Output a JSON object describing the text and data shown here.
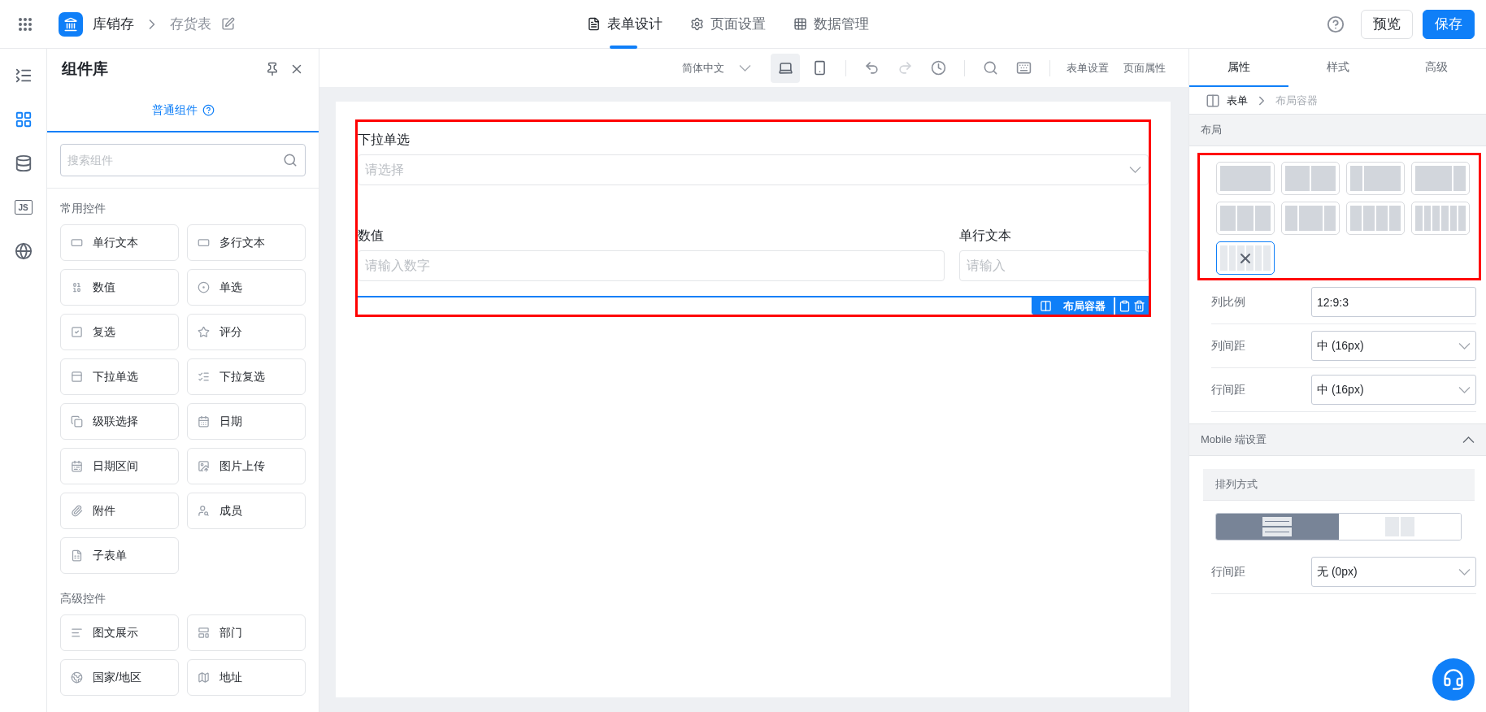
{
  "top_bar": {
    "app_name": "库销存",
    "breadcrumb": "存货表",
    "tabs": [
      {
        "kind": "form",
        "label": "表单设计",
        "selected": true
      },
      {
        "kind": "settings",
        "label": "页面设置",
        "selected": false
      },
      {
        "kind": "table",
        "label": "数据管理",
        "selected": false
      }
    ],
    "preview_button": "预览",
    "save_button": "保存"
  },
  "side_rail": [
    {
      "kind": "outline",
      "selected": false
    },
    {
      "kind": "components",
      "selected": true
    },
    {
      "kind": "data-source",
      "selected": false
    },
    {
      "kind": "script",
      "label": "JS",
      "selected": false
    },
    {
      "kind": "globe",
      "selected": false
    }
  ],
  "component_panel": {
    "title": "组件库",
    "tab": {
      "label": "普通组件",
      "selected": true
    },
    "search": {
      "placeholder": "搜索组件"
    },
    "groups": [
      {
        "title": "常用控件",
        "items": [
          {
            "kind": "text",
            "label": "单行文本"
          },
          {
            "kind": "textarea",
            "label": "多行文本"
          },
          {
            "kind": "number",
            "label": "数值"
          },
          {
            "kind": "radio",
            "label": "单选"
          },
          {
            "kind": "checkbox",
            "label": "复选"
          },
          {
            "kind": "rating",
            "label": "评分"
          },
          {
            "kind": "select",
            "label": "下拉单选"
          },
          {
            "kind": "multiselect",
            "label": "下拉复选"
          },
          {
            "kind": "cascade",
            "label": "级联选择"
          },
          {
            "kind": "date",
            "label": "日期"
          },
          {
            "kind": "daterange",
            "label": "日期区间"
          },
          {
            "kind": "image",
            "label": "图片上传"
          },
          {
            "kind": "attachment",
            "label": "附件"
          },
          {
            "kind": "member",
            "label": "成员"
          },
          {
            "kind": "subform",
            "label": "子表单"
          }
        ]
      },
      {
        "title": "高级控件",
        "items": [
          {
            "kind": "richtext",
            "label": "图文展示"
          },
          {
            "kind": "department",
            "label": "部门"
          },
          {
            "kind": "country",
            "label": "国家/地区"
          },
          {
            "kind": "address",
            "label": "地址"
          }
        ]
      }
    ]
  },
  "canvas_toolbar": {
    "language": "简体中文",
    "devices": [
      {
        "kind": "desktop",
        "selected": true
      },
      {
        "kind": "mobile",
        "selected": false
      }
    ],
    "links": [
      "表单设置",
      "页面属性"
    ]
  },
  "form": {
    "highlighted": true,
    "rows": [
      {
        "fields": [
          {
            "kind": "select",
            "label": "下拉单选",
            "placeholder": "请选择"
          }
        ]
      },
      {
        "fields": [
          {
            "kind": "input",
            "label": "数值",
            "placeholder": "请输入数字"
          },
          {
            "kind": "input",
            "label": "单行文本",
            "placeholder": "请输入"
          }
        ]
      }
    ],
    "container_tag": "布局容器"
  },
  "properties": {
    "tabs": [
      {
        "label": "属性",
        "selected": true
      },
      {
        "label": "样式",
        "selected": false
      },
      {
        "label": "高级",
        "selected": false
      }
    ],
    "breadcrumb": [
      "表单",
      "布局容器"
    ],
    "layout_section": "布局",
    "layout_options": {
      "highlighted": true,
      "items": [
        {
          "kind": "one",
          "selected": false
        },
        {
          "kind": "halves",
          "selected": false
        },
        {
          "kind": "narrow-wide",
          "selected": false
        },
        {
          "kind": "wide-narrow",
          "selected": false
        },
        {
          "kind": "thirds",
          "selected": false
        },
        {
          "kind": "narrow-wide-narrow",
          "selected": false
        },
        {
          "kind": "quarters",
          "selected": false
        },
        {
          "kind": "sixths",
          "selected": false
        },
        {
          "kind": "custom",
          "selected": true
        }
      ]
    },
    "fields": [
      {
        "kind": "input",
        "label": "列比例",
        "value": "12:9:3"
      },
      {
        "kind": "select",
        "label": "列间距",
        "value": "中 (16px)"
      },
      {
        "kind": "select",
        "label": "行间距",
        "value": "中 (16px)"
      }
    ],
    "mobile_section": {
      "title": "Mobile 端设置",
      "expanded": true,
      "arrangement_title": "排列方式",
      "arrangement": [
        {
          "kind": "stacked",
          "selected": true
        },
        {
          "kind": "side-by-side",
          "selected": false
        }
      ],
      "fields": [
        {
          "kind": "select",
          "label": "行间距",
          "value": "无 (0px)"
        }
      ]
    }
  }
}
